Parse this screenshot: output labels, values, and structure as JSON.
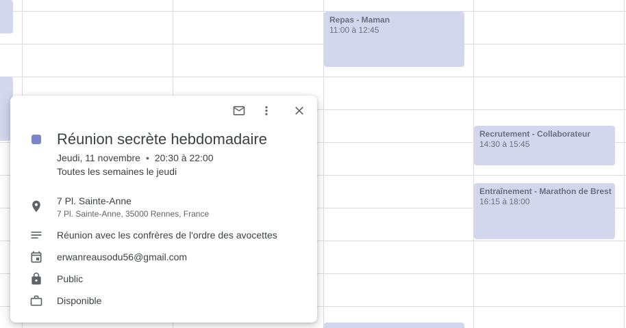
{
  "calendar": {
    "events": [
      {
        "title": "Repas - Maman",
        "time": "11:00 à 12:45"
      },
      {
        "title": "Recrutement - Collaborateur",
        "time": "14:30 à 15:45"
      },
      {
        "title": "Entraînement - Marathon de Brest",
        "time": "16:15 à 18:00"
      }
    ]
  },
  "popup": {
    "title": "Réunion secrète hebdomadaire",
    "date": "Jeudi, 11 novembre",
    "separator": "•",
    "time": "20:30 à 22:00",
    "recurrence": "Toutes les semaines le jeudi",
    "location_name": "7 Pl. Sainte-Anne",
    "location_address": "7 Pl. Sainte-Anne, 35000 Rennes, France",
    "description": "Réunion avec les confrères de l'ordre des avocettes",
    "calendar_owner": "erwanreausodu56@gmail.com",
    "visibility": "Public",
    "availability": "Disponible",
    "event_color": "#7986cb",
    "icons": [
      "email-icon",
      "more-options-icon",
      "close-icon",
      "location-icon",
      "description-icon",
      "calendar-icon",
      "lock-icon",
      "briefcase-icon"
    ]
  }
}
